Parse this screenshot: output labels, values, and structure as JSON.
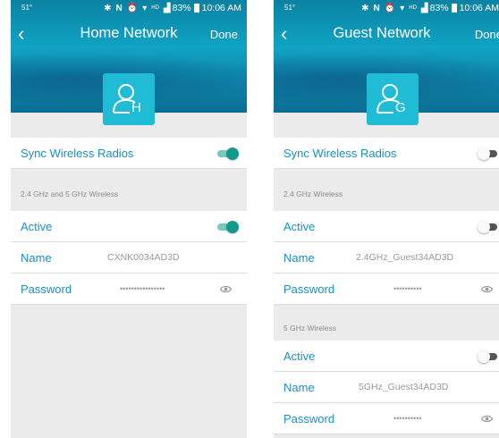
{
  "colors": {
    "accent": "#1a8fc2",
    "header": "#0c8db0",
    "toggle_on": "#13998a",
    "avatar": "#20bcd6"
  },
  "left": {
    "status": {
      "temp": "51°",
      "battery": "83%",
      "time": "10:06 AM",
      "signal": "HD"
    },
    "nav": {
      "back_icon": "chevron-left-icon",
      "title": "Home Network",
      "done": "Done"
    },
    "avatar": {
      "letter": "H",
      "icon": "user-icon"
    },
    "sync": {
      "label": "Sync Wireless Radios",
      "on": true
    },
    "section": "2.4 GHz and 5 GHz Wireless",
    "active": {
      "label": "Active",
      "on": true
    },
    "name": {
      "label": "Name",
      "value": "CXNK0034AD3D"
    },
    "password": {
      "label": "Password",
      "value": "••••••••••••••••",
      "icon": "eye-icon"
    }
  },
  "right": {
    "status": {
      "temp": "51°",
      "battery": "83%",
      "time": "10:06 AM",
      "signal": "HD"
    },
    "nav": {
      "back_icon": "chevron-left-icon",
      "title": "Guest Network",
      "done": "Done"
    },
    "avatar": {
      "letter": "G",
      "icon": "user-icon"
    },
    "sync": {
      "label": "Sync Wireless Radios",
      "on": false
    },
    "section_24": "2.4 GHz Wireless",
    "active_24": {
      "label": "Active",
      "on": false
    },
    "name_24": {
      "label": "Name",
      "value": "2.4GHz_Guest34AD3D"
    },
    "password_24": {
      "label": "Password",
      "value": "••••••••••",
      "icon": "eye-icon"
    },
    "section_5": "5 GHz Wireless",
    "active_5": {
      "label": "Active",
      "on": false
    },
    "name_5": {
      "label": "Name",
      "value": "5GHz_Guest34AD3D"
    },
    "password_5": {
      "label": "Password",
      "value": "••••••••••",
      "icon": "eye-icon"
    }
  }
}
